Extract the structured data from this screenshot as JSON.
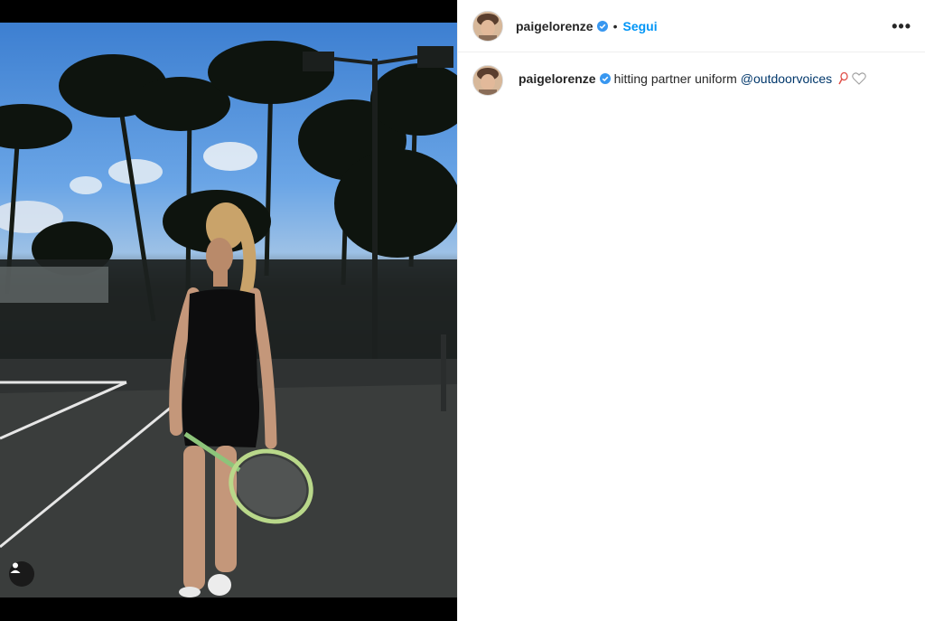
{
  "post": {
    "author": {
      "username": "paigelorenze",
      "verified": true,
      "follow_label": "Segui",
      "separator": "•"
    },
    "more_label": "•••",
    "caption": {
      "username": "paigelorenze",
      "text": "hitting partner uniform",
      "mention": "@outdoorvoices",
      "emoji": "tennis-racket-emoji"
    },
    "media": {
      "description_icon": "user-tag-icon"
    }
  },
  "colors": {
    "link": "#0095f6",
    "mention": "#00376b",
    "verified": "#3897f0",
    "text": "#262626"
  }
}
